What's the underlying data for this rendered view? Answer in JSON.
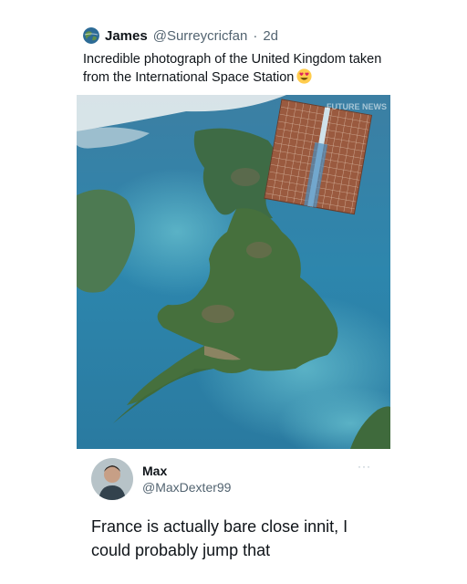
{
  "tweet": {
    "author_name": "James",
    "author_handle": "@Surreycricfan",
    "separator": "·",
    "age": "2d",
    "text": "Incredible photograph of the United Kingdom taken from the International Space Station",
    "emoji_icon": "heart-eyes-emoji",
    "image_watermark": "FUTURE NEWS"
  },
  "reply": {
    "author_name": "Max",
    "author_handle": "@MaxDexter99",
    "more_label": "···",
    "text": "France is actually bare close innit, I could probably jump that"
  },
  "colors": {
    "text_primary": "#0f1419",
    "text_secondary": "#536471",
    "sea": "#2e7fa6",
    "land": "#3f6b3e"
  }
}
